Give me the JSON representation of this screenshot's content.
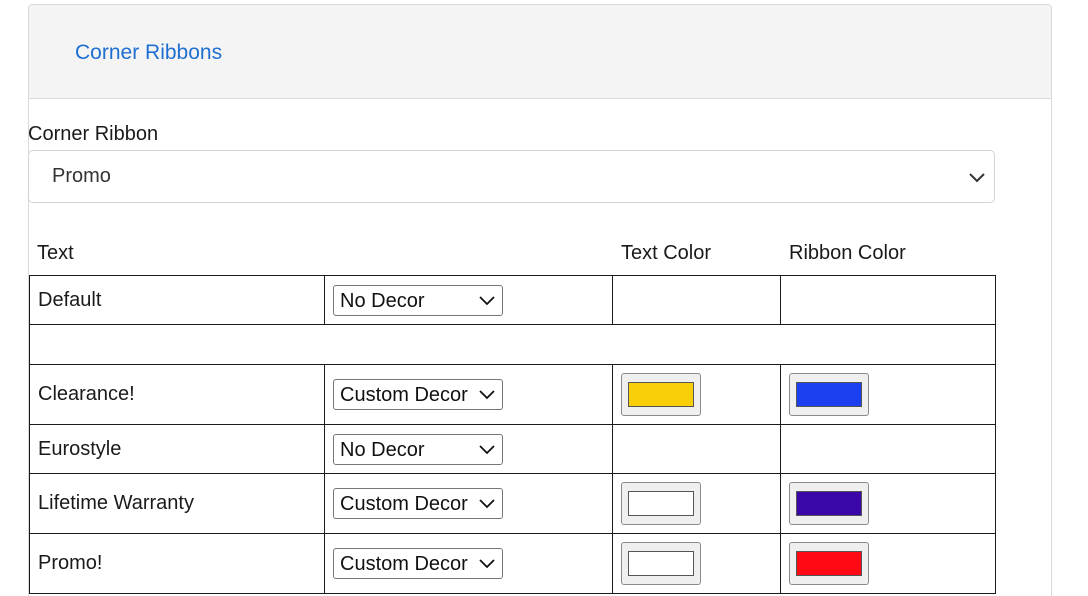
{
  "panel": {
    "title": "Corner Ribbons"
  },
  "field": {
    "label": "Corner Ribbon",
    "selected": "Promo"
  },
  "table": {
    "headers": {
      "text": "Text",
      "text_color": "Text Color",
      "ribbon_color": "Ribbon Color"
    },
    "rows": [
      {
        "text": "Default",
        "decor": "No Decor",
        "text_color": null,
        "ribbon_color": null
      },
      {
        "text": "Clearance!",
        "decor": "Custom Decor",
        "text_color": "#f9cf0a",
        "ribbon_color": "#1c3ff0"
      },
      {
        "text": "Eurostyle",
        "decor": "No Decor",
        "text_color": null,
        "ribbon_color": null
      },
      {
        "text": "Lifetime Warranty",
        "decor": "Custom Decor",
        "text_color": "#ffffff",
        "ribbon_color": "#3a06a8"
      },
      {
        "text": "Promo!",
        "decor": "Custom Decor",
        "text_color": "#ffffff",
        "ribbon_color": "#ff0a14"
      }
    ]
  },
  "icons": {
    "select_chevron": "chevron-down-icon"
  },
  "colors": {
    "title_link": "#1f6fd1",
    "header_bg": "#f4f4f4"
  }
}
